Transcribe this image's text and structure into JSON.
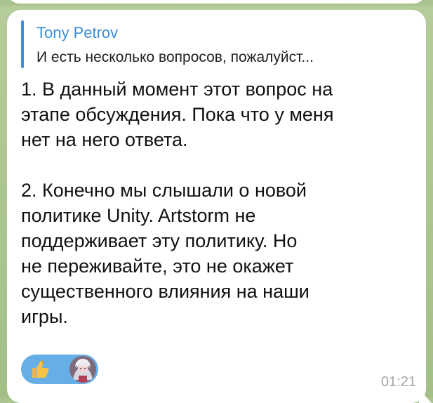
{
  "reply": {
    "author": "Tony Petrov",
    "text": "И есть несколько вопросов, пожалуйст..."
  },
  "message": {
    "text": "1. В данный момент этот вопрос на\nэтапе обсуждения. Пока что у меня\nнет на него ответа.\n\n2. Конечно мы слышали о новой\nполитике Unity. Artstorm не\nподдерживает эту политику. Но\nне переживайте, это не окажет\nсущественного влияния на наши\nигры.",
    "time": "01:21"
  },
  "reactions": [
    {
      "icon": "thumbs-up-icon"
    },
    {
      "icon": "avatar-icon"
    }
  ],
  "colors": {
    "bubble": "#ffffff",
    "chat_background": "#a9c48f",
    "reply_accent": "#3f8fd8",
    "reaction_pill": "#66aee6",
    "time": "#a1a8ae"
  }
}
